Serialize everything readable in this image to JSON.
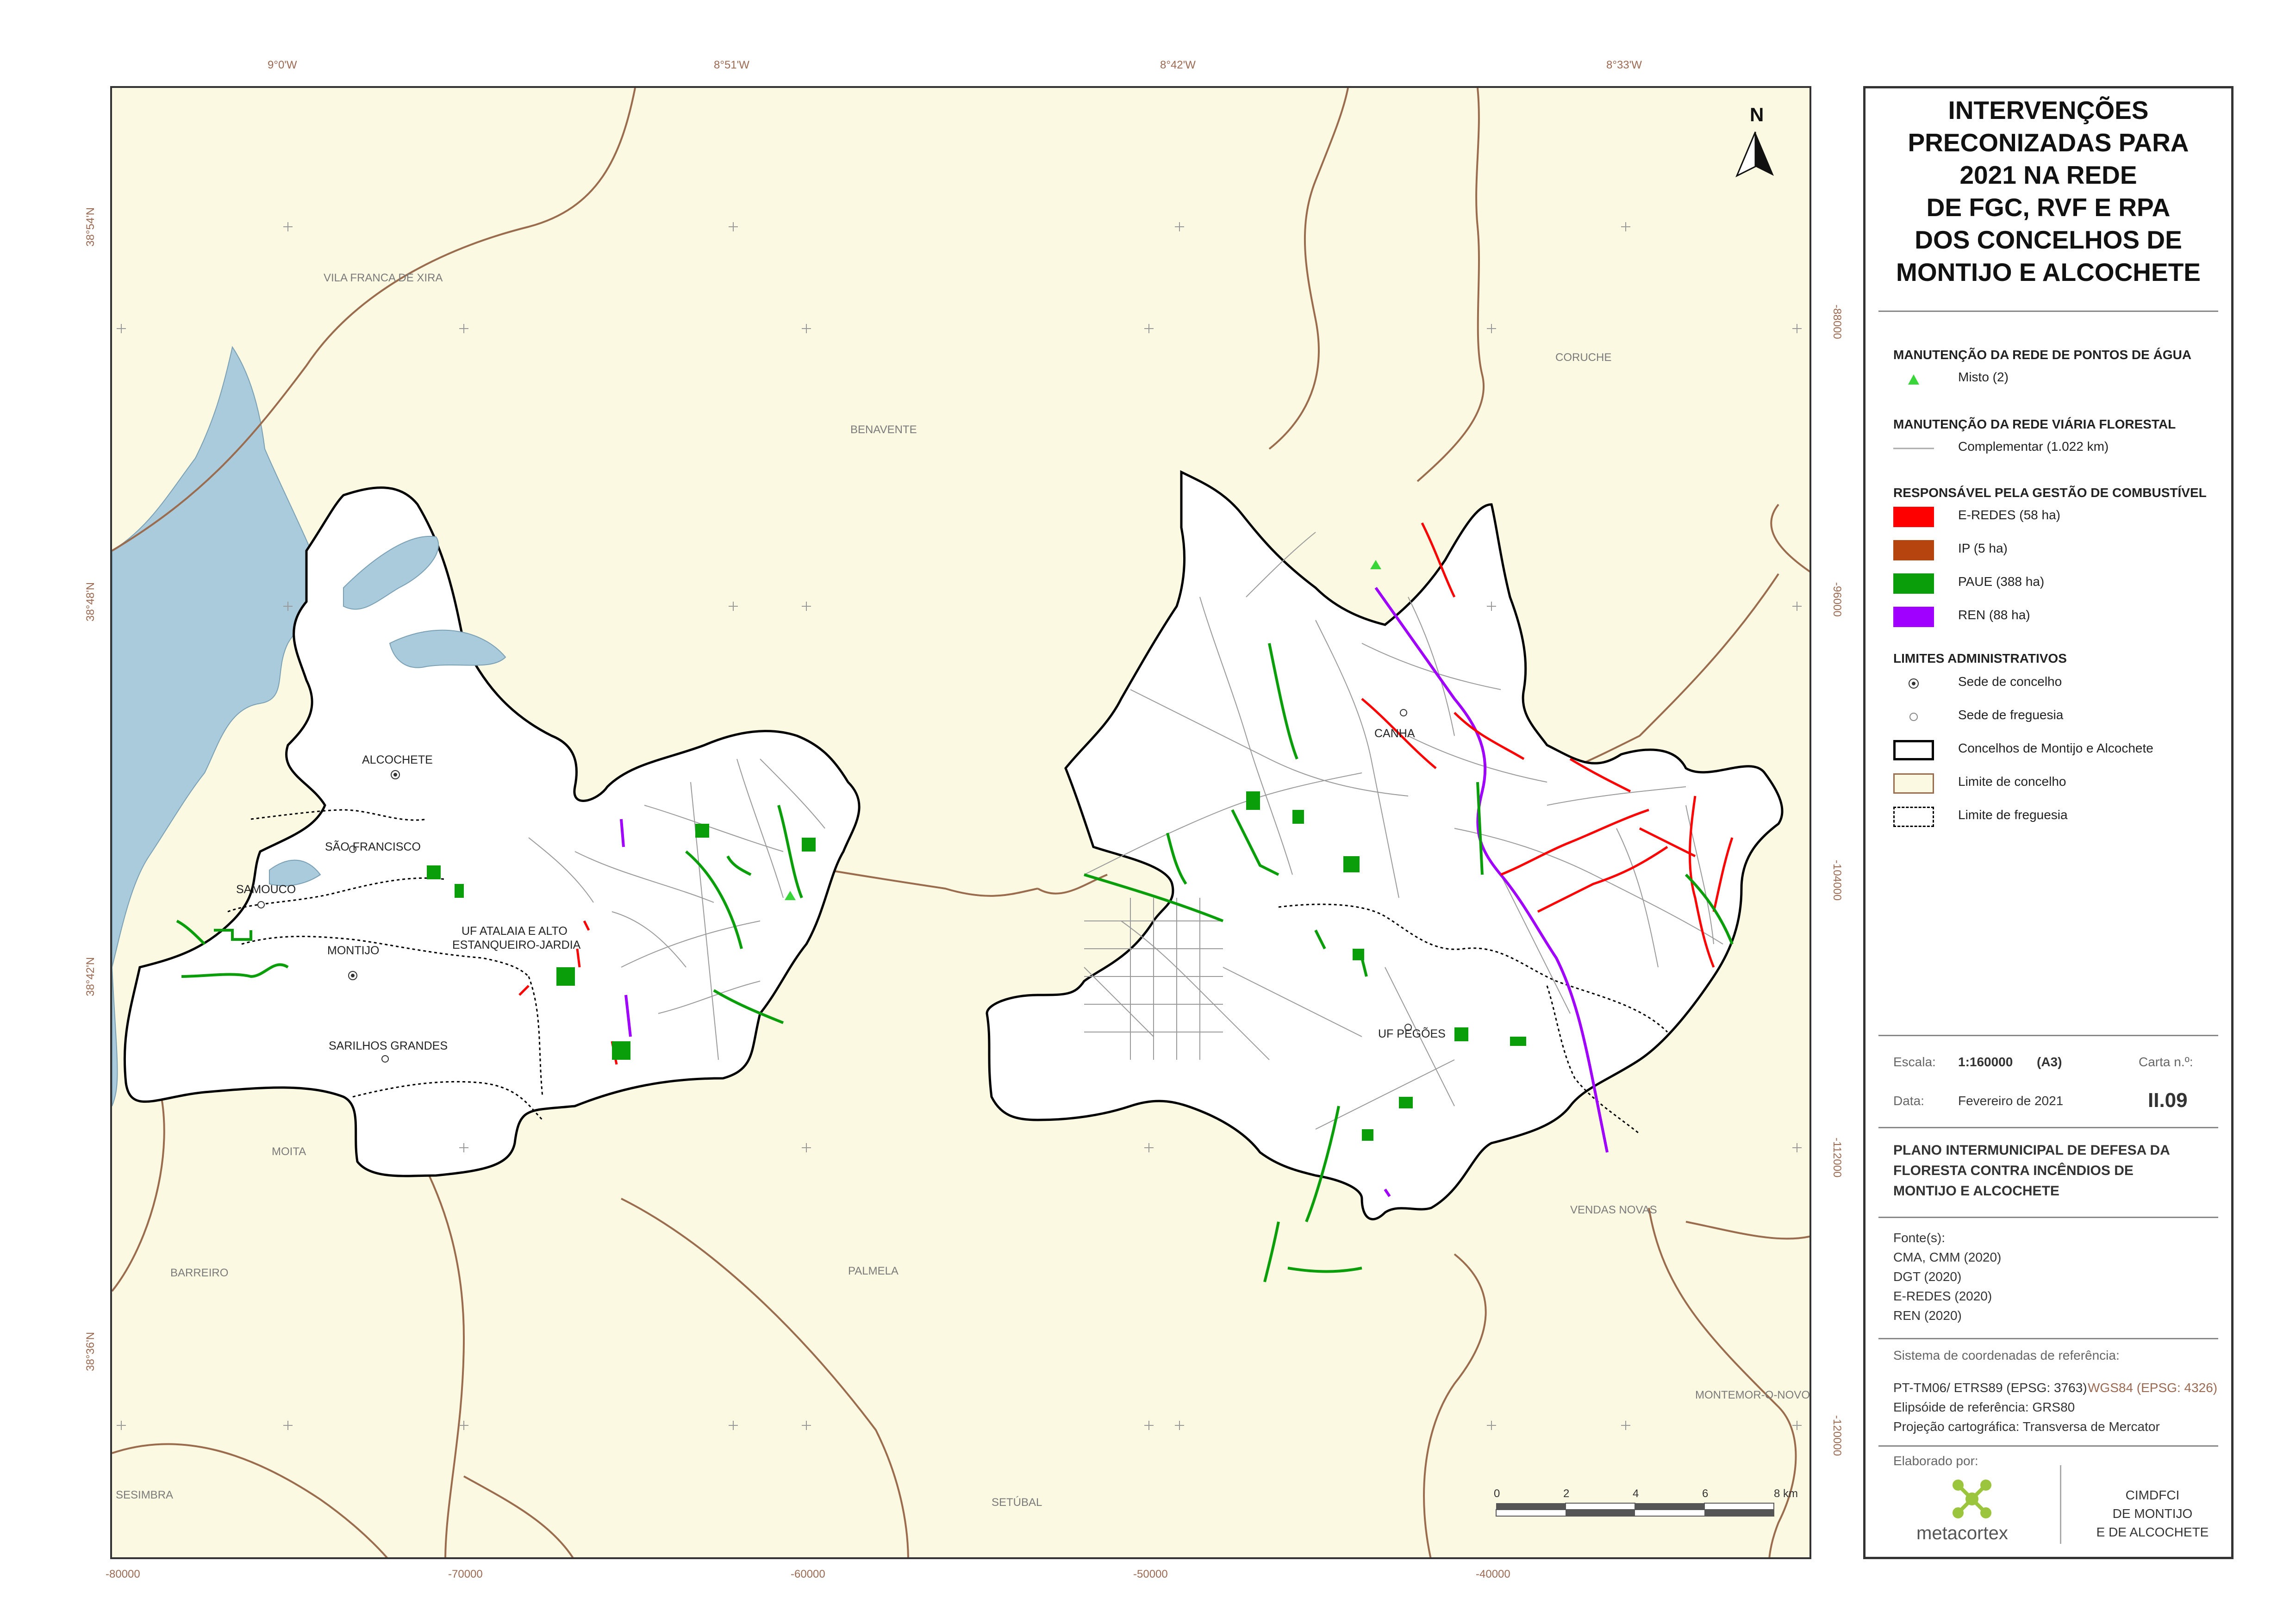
{
  "coords": {
    "top": [
      "9°0'W",
      "8°51'W",
      "8°42'W",
      "8°33'W"
    ],
    "left": [
      "38°54'N",
      "38°48'N",
      "38°42'N",
      "38°36'N"
    ],
    "bottom": [
      "-80000",
      "-70000",
      "-60000",
      "-50000",
      "-40000"
    ],
    "right": [
      "-88000",
      "-96000",
      "-104000",
      "-112000",
      "-120000"
    ]
  },
  "places": {
    "vila_franca": "VILA FRANCA DE XIRA",
    "benavente": "BENAVENTE",
    "coruche": "CORUCHE",
    "alcochete": "ALCOCHETE",
    "sao_francisco": "SÃO FRANCISCO",
    "samouco": "SAMOUCO",
    "montijo": "MONTIJO",
    "atalaia_1": "UF ATALAIA E ALTO",
    "atalaia_2": "ESTANQUEIRO-JARDIA",
    "sarilhos": "SARILHOS GRANDES",
    "canha": "CANHA",
    "pegoes": "UF PEGÕES",
    "moita": "MOITA",
    "barreiro": "BARREIRO",
    "palmela": "PALMELA",
    "vendas_novas": "VENDAS NOVAS",
    "montemor": "MONTEMOR-O-NOVO",
    "sesimbra": "SESIMBRA",
    "setubal": "SETÚBAL"
  },
  "north_label": "N",
  "scalebar": {
    "ticks": [
      "0",
      "2",
      "4",
      "6",
      "8 km"
    ]
  },
  "panel": {
    "title": [
      "INTERVENÇÕES",
      "PRECONIZADAS PARA",
      "2021 NA REDE",
      "DE FGC, RVF E RPA",
      "DOS CONCELHOS DE",
      "MONTIJO E ALCOCHETE"
    ],
    "sec_agua": "MANUTENÇÃO DA REDE DE PONTOS DE ÁGUA",
    "misto": "Misto (2)",
    "sec_viaria": "MANUTENÇÃO DA REDE VIÁRIA FLORESTAL",
    "complementar": "Complementar (1.022 km)",
    "sec_gestao": "RESPONSÁVEL PELA GESTÃO DE COMBUSTÍVEL",
    "eredes": "E-REDES (58 ha)",
    "ip": "IP (5  ha)",
    "paue": "PAUE (388 ha)",
    "ren": "REN (88 ha)",
    "sec_limites": "LIMITES ADMINISTRATIVOS",
    "sede_concelho": "Sede de concelho",
    "sede_freguesia": "Sede de freguesia",
    "concelhos": "Concelhos de Montijo e Alcochete",
    "limite_concelho": "Limite de concelho",
    "limite_freguesia": "Limite de freguesia",
    "escala_label": "Escala:",
    "escala_value": "1:160000",
    "escala_format": "(A3)",
    "carta_label": "Carta n.º:",
    "carta_value": "II.09",
    "data_label": "Data:",
    "data_value": "Fevereiro de 2021",
    "plano": [
      "PLANO INTERMUNICIPAL DE DEFESA DA",
      "FLORESTA CONTRA INCÊNDIOS DE",
      "MONTIJO E ALCOCHETE"
    ],
    "fontes_label": "Fonte(s):",
    "fontes": [
      "CMA, CMM (2020)",
      "DGT (2020)",
      "E-REDES (2020)",
      "REN (2020)"
    ],
    "sistema_label": "Sistema de coordenadas de referência:",
    "sistema_1a": "PT-TM06/ ETRS89 (EPSG: 3763)",
    "sistema_1b": "WGS84 (EPSG: 4326)",
    "elipsoide": "Elipsóide de referência: GRS80",
    "projecao": "Projeção cartográfica: Transversa de Mercator",
    "elaborado": "Elaborado por:",
    "metacortex": "metacortex",
    "cimdfci": [
      "CIMDFCI",
      "DE MONTIJO",
      "E DE ALCOCHETE"
    ]
  },
  "colors": {
    "eredes": "#ff0000",
    "ip": "#b5440f",
    "paue": "#0a9e0a",
    "ren": "#a000ff",
    "misto": "#39d639",
    "water": "#a9cbdc",
    "background": "#fbf9e1",
    "boundary": "#9a6b4d"
  }
}
